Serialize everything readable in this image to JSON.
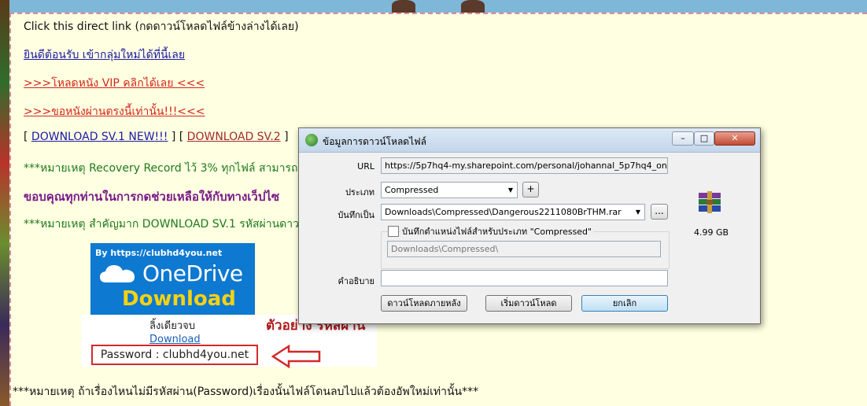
{
  "page": {
    "line1": "Click this direct link (กดดาวน์โหลดไฟล์ข้างล่างได้เลย)",
    "welcome_link": "ยินดีต้อนรับ เข้ากลุ่มใหม่ได้ที่นี้เลย",
    "vip_link": ">>>โหลดหนัง VIP คลิกได้เลย <<<",
    "request_link": ">>>ขอหนังผ่านตรงนี้เท่านั้น!!!<<<",
    "bracket_open": "[ ",
    "dl1": "DOWNLOAD SV.1 NEW!!!",
    "bracket_mid": " ] [ ",
    "dl2": "DOWNLOAD SV.2",
    "bracket_close": " ]",
    "note1": "***หมายเหตุ Recovery Record ไว้ 3% ทุกไฟล์ สามารถซ่",
    "thanks": "ขอบคุณทุกท่านในการกดช่วยเหลือให้กับทางเว็ปไซ",
    "note2": "***หมายเหตุ สำคัญมาก DOWNLOAD SV.1 รหัสผ่านดาวน์",
    "onedrive_by": "By https://clubhd4you.net",
    "onedrive_name": "OneDrive",
    "onedrive_dl": "Download",
    "oneclick": "ลิ้งเดียวจบ",
    "download_link": "Download",
    "password": "Password : clubhd4you.net",
    "sample": "ตัวอย่าง รหัสผ่าน",
    "bottom_note": "***หมายเหตุ ถ้าเรื่องไหนไม่มีรหัสผ่าน(Password)เรื่องนั้นไฟล์โดนลบไปแล้วต้องอัพใหม่เท่านั้น***"
  },
  "dialog": {
    "title": "ข้อมูลการดาวน์โหลดไฟล์",
    "url_label": "URL",
    "url_value": "https://5p7hq4-my.sharepoint.com/personal/johannal_5p7hq4_onmicrosof",
    "type_label": "ประเภท",
    "type_value": "Compressed",
    "add_symbol": "+",
    "saveas_label": "บันทึกเป็น",
    "saveas_value": "Downloads\\Compressed\\Dangerous2211080BrTHM.rar",
    "browse_symbol": "...",
    "remember_label": "บันทึกตำแหน่งไฟล์สำหรับประเภท \"Compressed\"",
    "remember_path": "Downloads\\Compressed\\",
    "desc_label": "คำอธิบาย",
    "desc_value": "",
    "file_size": "4.99  GB",
    "later_button": "ดาวน์โหลดภายหลัง",
    "start_button": "เริ่มดาวน์โหลด",
    "cancel_button": "ยกเลิก",
    "min_symbol": "–",
    "max_symbol": "□",
    "close_symbol": "✕"
  }
}
